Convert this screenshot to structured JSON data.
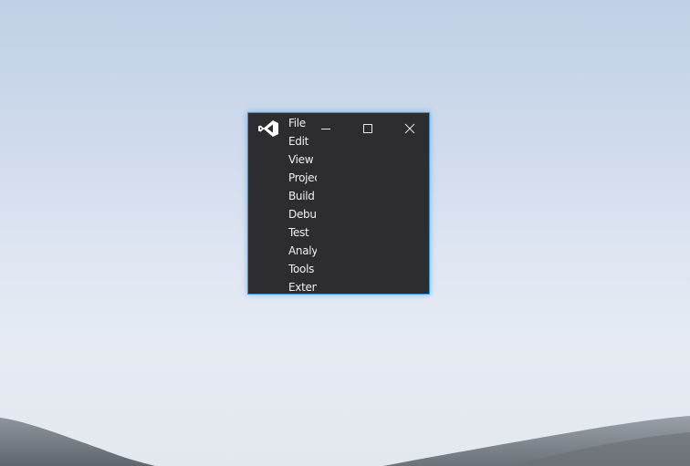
{
  "window": {
    "app_icon": "visual-studio-logo-icon",
    "accent_border": "#3a96dd",
    "background": "#2d2d30"
  },
  "menu": {
    "items": [
      {
        "label": "File"
      },
      {
        "label": "Edit"
      },
      {
        "label": "View"
      },
      {
        "label": "Project"
      },
      {
        "label": "Build"
      },
      {
        "label": "Debug"
      },
      {
        "label": "Test"
      },
      {
        "label": "Analyze"
      },
      {
        "label": "Tools"
      },
      {
        "label": "Extensions"
      }
    ]
  },
  "caption_buttons": {
    "minimize": "minimize-icon",
    "maximize": "maximize-icon",
    "close": "close-icon"
  }
}
